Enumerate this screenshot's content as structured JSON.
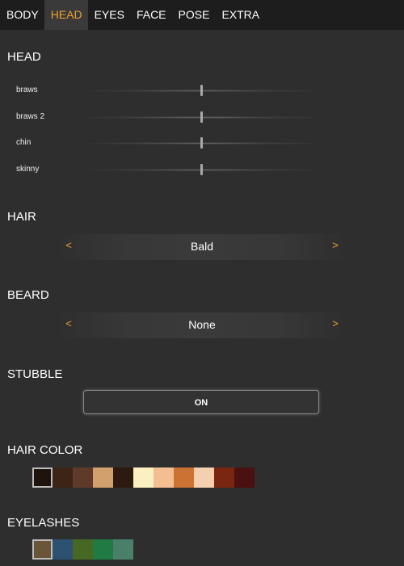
{
  "tabs": [
    {
      "label": "BODY",
      "active": false
    },
    {
      "label": "HEAD",
      "active": true
    },
    {
      "label": "EYES",
      "active": false
    },
    {
      "label": "FACE",
      "active": false
    },
    {
      "label": "POSE",
      "active": false
    },
    {
      "label": "EXTRA",
      "active": false
    }
  ],
  "head": {
    "title": "HEAD",
    "sliders": [
      {
        "label": "braws",
        "value": 0.5
      },
      {
        "label": "braws 2",
        "value": 0.5
      },
      {
        "label": "chin",
        "value": 0.5
      },
      {
        "label": "skinny",
        "value": 0.5
      }
    ]
  },
  "hair": {
    "title": "HAIR",
    "value": "Bald",
    "prev": "<",
    "next": ">"
  },
  "beard": {
    "title": "BEARD",
    "value": "None",
    "prev": "<",
    "next": ">"
  },
  "stubble": {
    "title": "STUBBLE",
    "toggle": "ON"
  },
  "hair_color": {
    "title": "HAIR COLOR",
    "selected_index": 0,
    "swatches": [
      "#1f130e",
      "#3e2416",
      "#5f3a2a",
      "#d2a06d",
      "#2c1a0e",
      "#fbf0c1",
      "#f4bf90",
      "#cc7233",
      "#f4cfb0",
      "#7a2611",
      "#4b1010"
    ]
  },
  "eyelashes": {
    "title": "EYELASHES",
    "selected_index": 0,
    "swatches": [
      "#6b5538",
      "#2d5170",
      "#466822",
      "#1f7a44",
      "#4a8069"
    ]
  },
  "colors": {
    "accent": "#f0a030",
    "background": "#2e2e2e",
    "tabbar": "#1d1d1d"
  }
}
